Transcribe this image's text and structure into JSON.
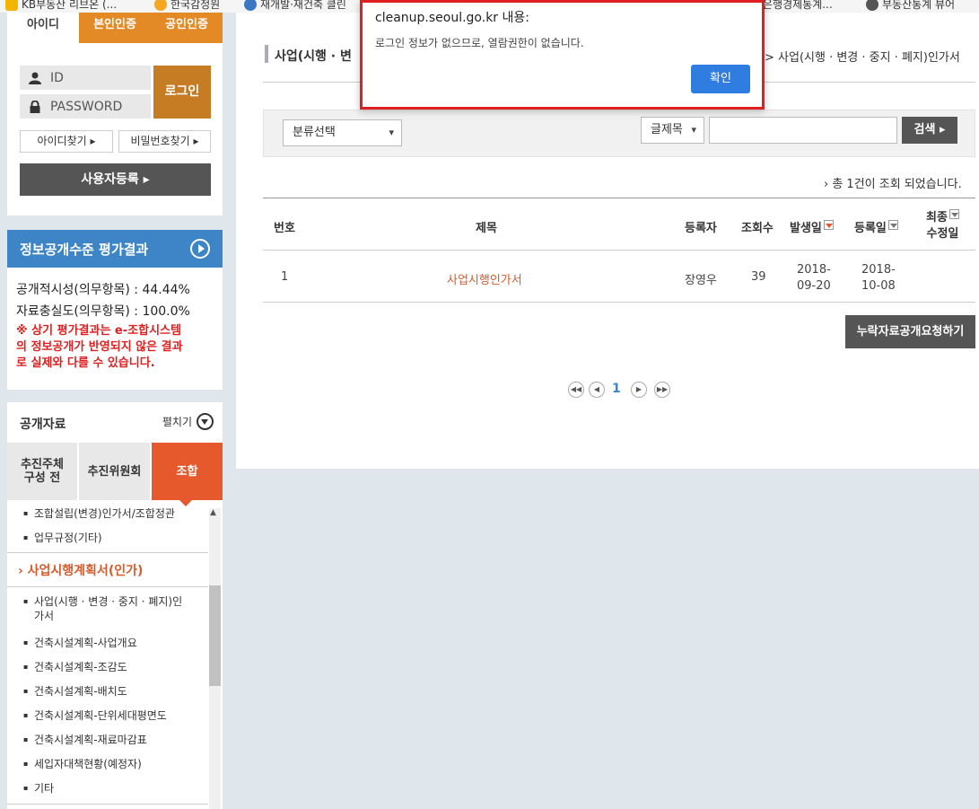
{
  "bookmarks": [
    "KB부동산 리브온 (...",
    "한국감정원",
    "재개발·재건축 클린",
    "은행경제통계...",
    "부동산통계 뷰어"
  ],
  "login": {
    "tabs": [
      "아이디",
      "본인인증",
      "공인인증"
    ],
    "id_label": "ID",
    "pw_label": "PASSWORD",
    "login_button": "로그인",
    "find_id": "아이디찾기",
    "find_pw": "비밀번호찾기",
    "register": "사용자등록"
  },
  "evaluation": {
    "title": "정보공개수준 평가결과",
    "line1": "공개적시성(의무항목) : 44.44%",
    "line2": "자료충실도(의무항목) : 100.0%",
    "note": [
      "※ 상기 평가결과는 e-조합시스템",
      "의 정보공개가 반영되지 않은 결과",
      "로 실제와 다를 수 있습니다."
    ]
  },
  "public_data": {
    "title": "공개자료",
    "expand": "펼치기",
    "tabs": [
      [
        "추진주체",
        "구성 전"
      ],
      [
        "추진위원회"
      ],
      [
        "조합"
      ]
    ],
    "top_items": [
      "조합설립(변경)인가서/조합정관",
      "업무규정(기타)"
    ],
    "section": "사업시행계획서(인가)",
    "items": [
      [
        "사업(시행 · 변경 · 중지 · 폐지)인",
        "가서"
      ],
      [
        "건축시설계획-사업개요"
      ],
      [
        "건축시설계획-조감도"
      ],
      [
        "건축시설계획-배치도"
      ],
      [
        "건축시설계획-단위세대평면도"
      ],
      [
        "건축시설계획-재료마감표"
      ],
      [
        "세입자대책현황(예정자)"
      ],
      [
        "기타"
      ]
    ]
  },
  "main": {
    "title": "사업(시행 · 변",
    "breadcrumb": "> 사업(시행 · 변경 · 중지 · 폐지)인가서",
    "category_select": "분류선택",
    "field_select": "글제목",
    "search_button": "검색",
    "count_text": "› 총 1건이 조회 되었습니다.",
    "headers": {
      "no": "번호",
      "title": "제목",
      "author": "등록자",
      "views": "조회수",
      "date_occ": "발생일",
      "date_reg": "등록일",
      "last_mod": [
        "최종",
        "수정일"
      ]
    },
    "rows": [
      {
        "no": "1",
        "title": "사업시행인가서",
        "author": "장영우",
        "views": "39",
        "date_occ": [
          "2018-",
          "09-20"
        ],
        "date_reg": [
          "2018-",
          "10-08"
        ]
      }
    ],
    "missing_button": "누락자료공개요청하기",
    "page": "1"
  },
  "dialog": {
    "title": "cleanup.seoul.go.kr 내용:",
    "message": "로그인 정보가 없으므로, 열람권한이 없습니다.",
    "ok": "확인"
  },
  "colors": {
    "accent_orange": "#e6592c",
    "login_orange": "#c57c22",
    "blue": "#3d85c6",
    "dialog_border": "#e02020",
    "ok_button": "#2f7de1"
  }
}
